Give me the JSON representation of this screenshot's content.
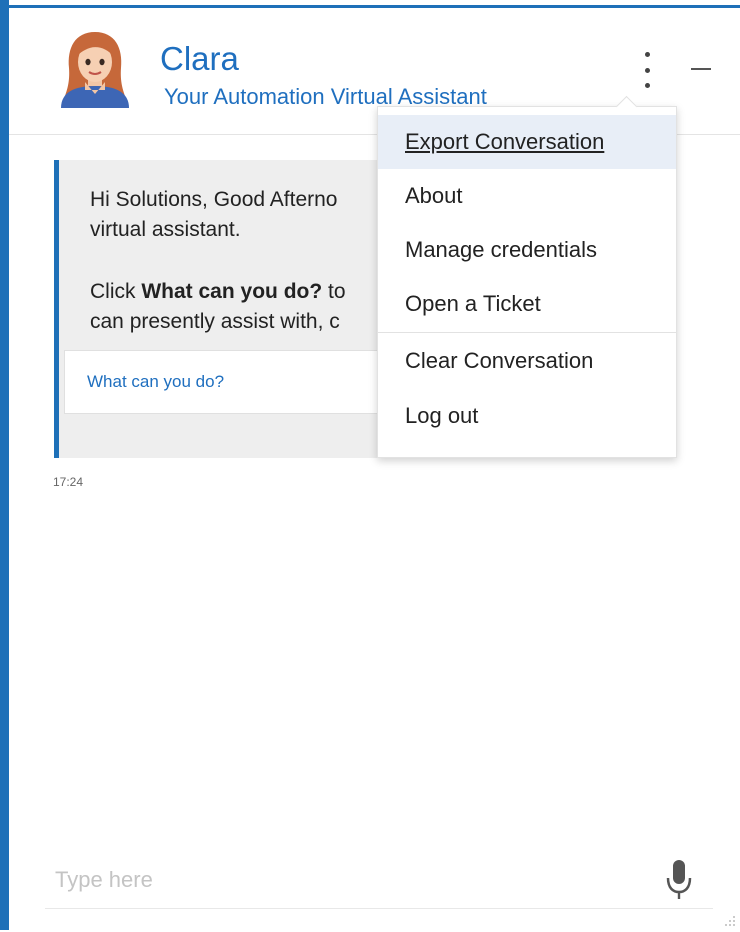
{
  "header": {
    "name": "Clara",
    "subtitle": "Your Automation Virtual Assistant"
  },
  "icons": {
    "avatar": "female-avatar-icon",
    "more": "kebab-menu-icon",
    "minimize": "minimize-icon",
    "microphone": "microphone-icon",
    "resize": "resize-grip-icon"
  },
  "message": {
    "line1": "Hi Solutions, Good Afterno",
    "line2": "virtual assistant.",
    "line3_prefix": "Click ",
    "line3_bold": "What can you do?",
    "line3_suffix": " to",
    "line4": "can presently assist with, c",
    "quick_reply": "What can you do?",
    "time": "17:24"
  },
  "menu": {
    "items": [
      {
        "label": "Export Conversation"
      },
      {
        "label": "About"
      },
      {
        "label": "Manage credentials"
      },
      {
        "label": "Open a Ticket"
      },
      {
        "label": "Clear Conversation"
      },
      {
        "label": "Log out"
      }
    ]
  },
  "input": {
    "placeholder": "Type here",
    "value": ""
  },
  "colors": {
    "accent": "#1e70b8",
    "link": "#1f6fbf",
    "card_bg": "#eeeeee",
    "menu_highlight": "#e8eef7"
  }
}
